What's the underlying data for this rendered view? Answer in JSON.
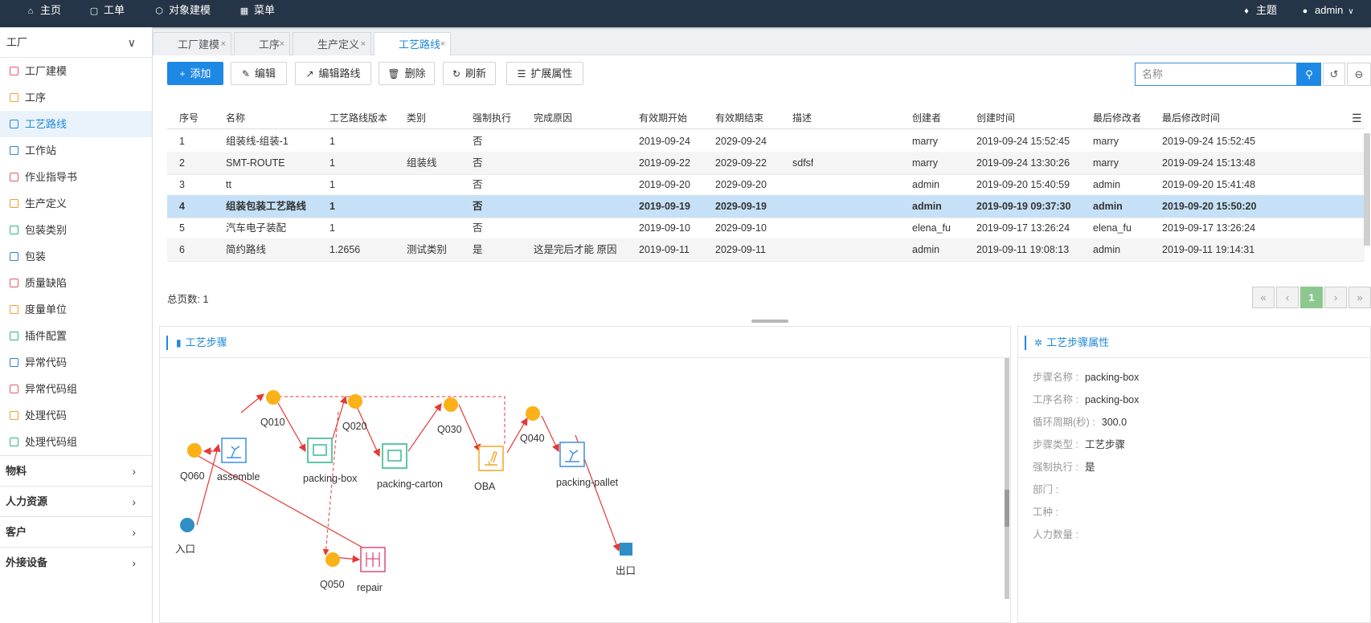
{
  "topbar": {
    "home": "主页",
    "order": "工单",
    "modeling": "对象建模",
    "menu": "菜单",
    "theme": "主题",
    "user": "admin"
  },
  "sidebar": {
    "section": "工厂",
    "items": [
      {
        "label": "工厂建模",
        "color": "#e25a6a"
      },
      {
        "label": "工序",
        "color": "#f0a030"
      },
      {
        "label": "工艺路线",
        "color": "#1e88d8"
      },
      {
        "label": "工作站",
        "color": "#2f7fd0"
      },
      {
        "label": "作业指导书",
        "color": "#e25a6a"
      },
      {
        "label": "生产定义",
        "color": "#f0a030"
      },
      {
        "label": "包装类别",
        "color": "#2bb48a"
      },
      {
        "label": "包装",
        "color": "#2f7fd0"
      },
      {
        "label": "质量缺陷",
        "color": "#e25a6a"
      },
      {
        "label": "度量单位",
        "color": "#f0a030"
      },
      {
        "label": "插件配置",
        "color": "#2bb48a"
      },
      {
        "label": "异常代码",
        "color": "#2f7fd0"
      },
      {
        "label": "异常代码组",
        "color": "#e25a6a"
      },
      {
        "label": "处理代码",
        "color": "#f0a030"
      },
      {
        "label": "处理代码组",
        "color": "#2bb48a"
      }
    ],
    "groups": [
      "物料",
      "人力资源",
      "客户",
      "外接设备"
    ]
  },
  "tabs": [
    "工厂建模",
    "工序",
    "生产定义",
    "工艺路线"
  ],
  "toolbar": {
    "add": "添加",
    "edit": "编辑",
    "edit_route": "编辑路线",
    "delete": "删除",
    "refresh": "刷新",
    "ext_attr": "扩展属性",
    "search_placeholder": "名称"
  },
  "table": {
    "headers": [
      "序号",
      "名称",
      "工艺路线版本",
      "类别",
      "强制执行",
      "完成原因",
      "有效期开始",
      "有效期结束",
      "描述",
      "创建者",
      "创建时间",
      "最后修改者",
      "最后修改时间"
    ],
    "rows": [
      [
        "1",
        "组装线-组装-1",
        "1",
        "",
        "否",
        "",
        "2019-09-24",
        "2029-09-24",
        "",
        "marry",
        "2019-09-24 15:52:45",
        "marry",
        "2019-09-24 15:52:45"
      ],
      [
        "2",
        "SMT-ROUTE",
        "1",
        "组装线",
        "否",
        "",
        "2019-09-22",
        "2029-09-22",
        "sdfsf",
        "marry",
        "2019-09-24 13:30:26",
        "marry",
        "2019-09-24 15:13:48"
      ],
      [
        "3",
        "tt",
        "1",
        "",
        "否",
        "",
        "2019-09-20",
        "2029-09-20",
        "",
        "admin",
        "2019-09-20 15:40:59",
        "admin",
        "2019-09-20 15:41:48"
      ],
      [
        "4",
        "组装包装工艺路线",
        "1",
        "",
        "否",
        "",
        "2019-09-19",
        "2029-09-19",
        "",
        "admin",
        "2019-09-19 09:37:30",
        "admin",
        "2019-09-20 15:50:20"
      ],
      [
        "5",
        "汽车电子装配",
        "1",
        "",
        "否",
        "",
        "2019-09-10",
        "2029-09-10",
        "",
        "elena_fu",
        "2019-09-17 13:26:24",
        "elena_fu",
        "2019-09-17 13:26:24"
      ],
      [
        "6",
        "简约路线",
        "1.2656",
        "测试类别",
        "是",
        "这是完后才能 原因",
        "2019-09-11",
        "2029-09-11",
        "",
        "admin",
        "2019-09-11 19:08:13",
        "admin",
        "2019-09-11 19:14:31"
      ]
    ],
    "total": "总页数: 1",
    "page": "1"
  },
  "steps_panel": {
    "title": "工艺步骤",
    "nodes": {
      "q060": "Q060",
      "assemble": "assemble",
      "q010": "Q010",
      "packing_box": "packing-box",
      "q020": "Q020",
      "packing_carton": "packing-carton",
      "q030": "Q030",
      "oba": "OBA",
      "q040": "Q040",
      "packing_pallet": "packing-pallet",
      "entry": "入口",
      "q050": "Q050",
      "repair": "repair",
      "exit": "出口"
    }
  },
  "props_panel": {
    "title": "工艺步骤属性",
    "fields": [
      {
        "label": "步骤名称 :",
        "value": "packing-box"
      },
      {
        "label": "工序名称 :",
        "value": "packing-box"
      },
      {
        "label": "循环周期(秒) :",
        "value": "300.0"
      },
      {
        "label": "步骤类型 :",
        "value": "工艺步骤"
      },
      {
        "label": "强制执行 :",
        "value": "是"
      },
      {
        "label": "部门 :",
        "value": ""
      },
      {
        "label": "工种 :",
        "value": ""
      },
      {
        "label": "人力数量 :",
        "value": ""
      }
    ]
  }
}
